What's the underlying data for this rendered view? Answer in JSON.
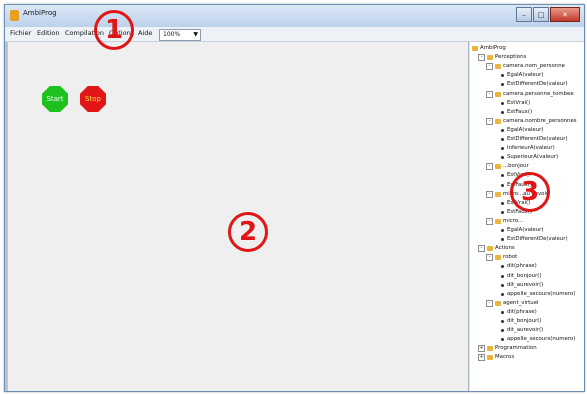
{
  "window": {
    "title": "AmbiProg"
  },
  "menu": {
    "items": [
      "Fichier",
      "Edition",
      "Compilation",
      "Options",
      "Aide"
    ],
    "zoom": "100%"
  },
  "canvas": {
    "start_label": "Start",
    "stop_label": "Stop"
  },
  "tree": [
    {
      "label": "AmbiProg",
      "level": 0,
      "kind": "root"
    },
    {
      "label": "Perceptions",
      "level": 1,
      "kind": "folder",
      "expanded": true
    },
    {
      "label": "camera.nom_personne",
      "level": 2,
      "kind": "folder",
      "expanded": true
    },
    {
      "label": "EgalA(valeur)",
      "level": 3,
      "kind": "leaf"
    },
    {
      "label": "EstDifferentDe(valeur)",
      "level": 3,
      "kind": "leaf"
    },
    {
      "label": "camera.personne_tombee",
      "level": 2,
      "kind": "folder",
      "expanded": true
    },
    {
      "label": "EstVrai()",
      "level": 3,
      "kind": "leaf"
    },
    {
      "label": "EstFaux()",
      "level": 3,
      "kind": "leaf"
    },
    {
      "label": "camera.nombre_personnes",
      "level": 2,
      "kind": "folder",
      "expanded": true
    },
    {
      "label": "EgalA(valeur)",
      "level": 3,
      "kind": "leaf"
    },
    {
      "label": "EstDifferentDe(valeur)",
      "level": 3,
      "kind": "leaf"
    },
    {
      "label": "InferieurA(valeur)",
      "level": 3,
      "kind": "leaf"
    },
    {
      "label": "SuperieurA(valeur)",
      "level": 3,
      "kind": "leaf"
    },
    {
      "label": "...bonjour",
      "level": 2,
      "kind": "folder",
      "expanded": true
    },
    {
      "label": "EstVrai()",
      "level": 3,
      "kind": "leaf"
    },
    {
      "label": "EstFaux()",
      "level": 3,
      "kind": "leaf"
    },
    {
      "label": "micro...au_revoir",
      "level": 2,
      "kind": "folder",
      "expanded": true
    },
    {
      "label": "EstVrai()",
      "level": 3,
      "kind": "leaf"
    },
    {
      "label": "EstFaux()",
      "level": 3,
      "kind": "leaf"
    },
    {
      "label": "micro...",
      "level": 2,
      "kind": "folder",
      "expanded": true
    },
    {
      "label": "EgalA(valeur)",
      "level": 3,
      "kind": "leaf"
    },
    {
      "label": "EstDifferentDe(valeur)",
      "level": 3,
      "kind": "leaf"
    },
    {
      "label": "Actions",
      "level": 1,
      "kind": "folder",
      "expanded": true
    },
    {
      "label": "robot",
      "level": 2,
      "kind": "folder",
      "expanded": true
    },
    {
      "label": "dit(phrase)",
      "level": 3,
      "kind": "leaf"
    },
    {
      "label": "dit_bonjour()",
      "level": 3,
      "kind": "leaf"
    },
    {
      "label": "dit_aurevoir()",
      "level": 3,
      "kind": "leaf"
    },
    {
      "label": "appelle_secours(numero)",
      "level": 3,
      "kind": "leaf"
    },
    {
      "label": "agent_virtuel",
      "level": 2,
      "kind": "folder",
      "expanded": true
    },
    {
      "label": "dit(phrase)",
      "level": 3,
      "kind": "leaf"
    },
    {
      "label": "dit_bonjour()",
      "level": 3,
      "kind": "leaf"
    },
    {
      "label": "dit_aurevoir()",
      "level": 3,
      "kind": "leaf"
    },
    {
      "label": "appelle_secours(numero)",
      "level": 3,
      "kind": "leaf"
    },
    {
      "label": "Programmation",
      "level": 1,
      "kind": "folder",
      "expanded": false
    },
    {
      "label": "Macros",
      "level": 1,
      "kind": "folder",
      "expanded": false
    }
  ],
  "annotations": [
    "1",
    "2",
    "3"
  ]
}
